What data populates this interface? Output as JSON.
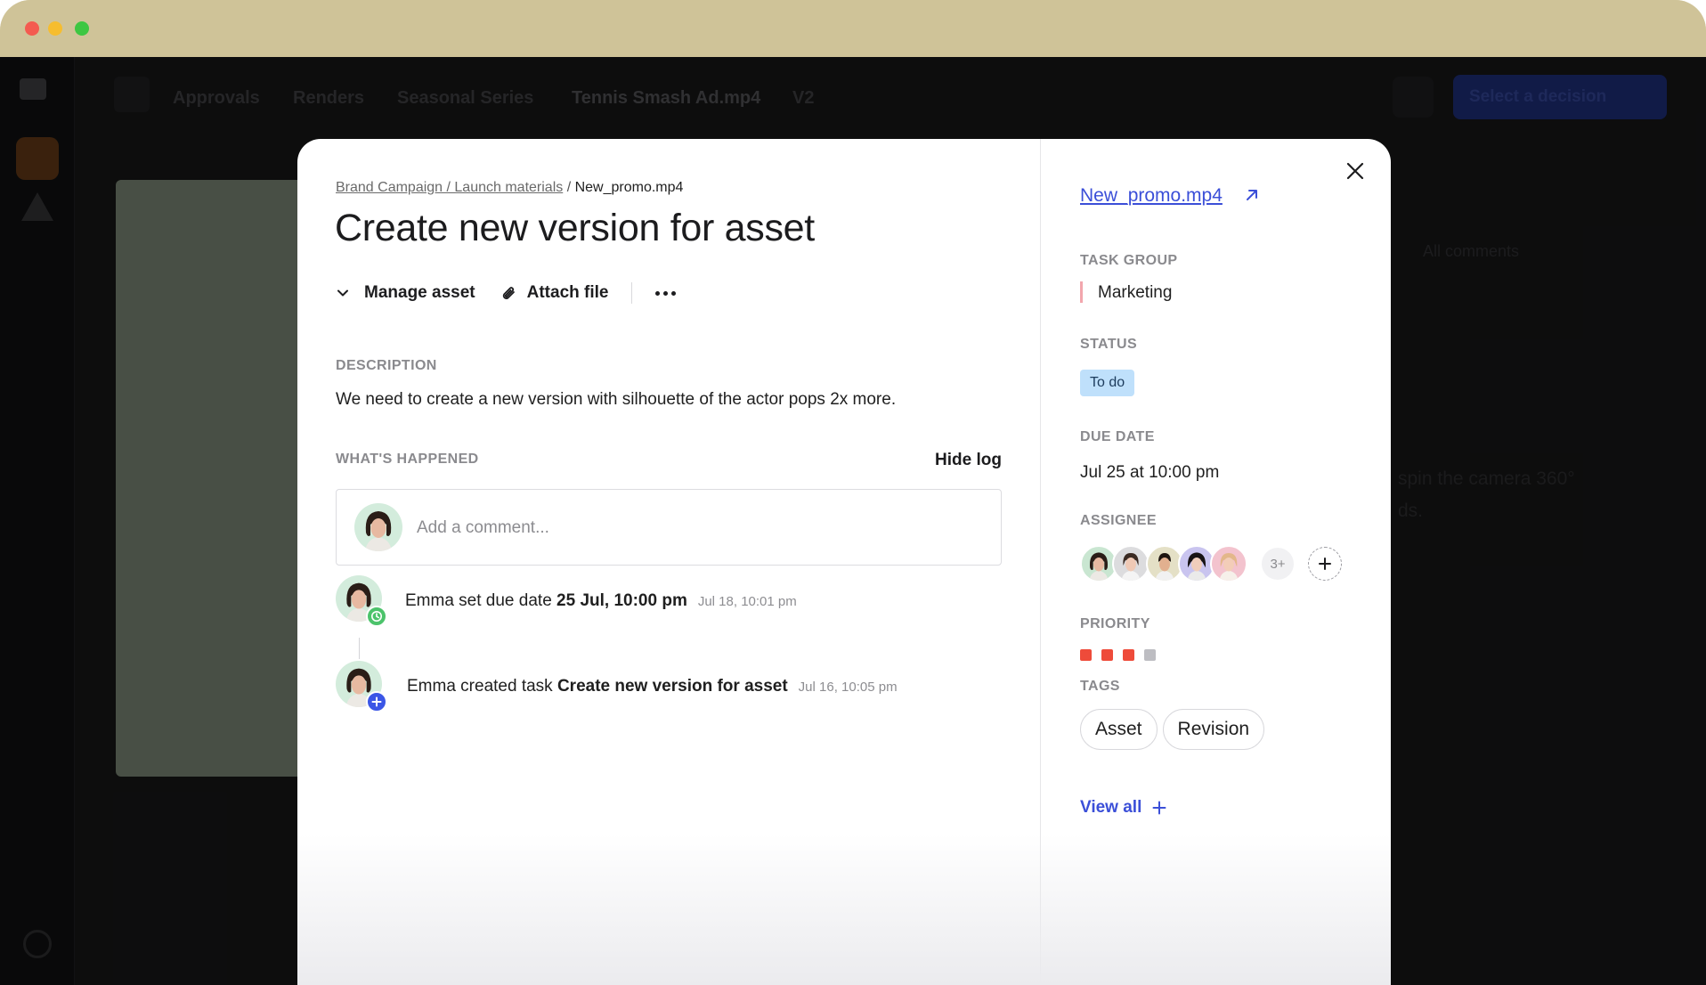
{
  "background_app": {
    "breadcrumb": [
      "Approvals",
      "Renders",
      "Seasonal Series",
      "Tennis Smash Ad.mp4"
    ],
    "version": "V2",
    "decision_button": "Select a decision",
    "comments_filter": "All comments",
    "comment_snippet": "spin the camera 360°",
    "comment_snippet_2": "ds."
  },
  "modal": {
    "breadcrumb": {
      "parent": "Brand Campaign / Launch materials",
      "separator": " / ",
      "current": "New_promo.mp4"
    },
    "title": "Create new version for asset",
    "actions": {
      "manage": "Manage asset",
      "attach": "Attach file"
    },
    "description": {
      "label": "DESCRIPTION",
      "text": "We need to create a new version with silhouette of the actor pops 2x more."
    },
    "log": {
      "label": "WHAT'S HAPPENED",
      "toggle": "Hide log",
      "comment_placeholder": "Add a comment...",
      "entries": [
        {
          "prefix": "Emma set due date ",
          "bold": "25 Jul, 10:00 pm",
          "time": "Jul 18, 10:01 pm",
          "badge": "clock-icon"
        },
        {
          "prefix": "Emma created task ",
          "bold": "Create new version for asset",
          "time": "Jul 16, 10:05 pm",
          "badge": "plus-icon"
        }
      ]
    },
    "side": {
      "file": "New_promo.mp4",
      "task_group_label": "TASK GROUP",
      "task_group": "Marketing",
      "status_label": "STATUS",
      "status": "To do",
      "due_label": "DUE DATE",
      "due": "Jul 25 at 10:00 pm",
      "assignee_label": "ASSIGNEE",
      "assignee_more": "3+",
      "priority_label": "PRIORITY",
      "priority_level": 3,
      "priority_max": 4,
      "tags_label": "TAGS",
      "tags": [
        "Asset",
        "Revision"
      ],
      "view_all": "View all"
    }
  },
  "colors": {
    "accent": "#3b4fd8",
    "status_bg": "#bfe0fb",
    "priority_on": "#ee4b3a",
    "priority_off": "#bdbdc2",
    "group_marker": "#f2a6ad"
  }
}
